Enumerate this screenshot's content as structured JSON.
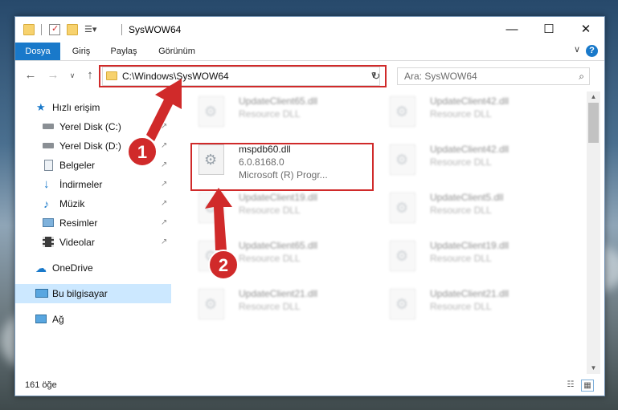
{
  "window": {
    "title": "SysWOW64",
    "controls": {
      "minimize": "—",
      "maximize": "☐",
      "close": "✕"
    }
  },
  "ribbon": {
    "tabs": [
      "Dosya",
      "Giriş",
      "Paylaş",
      "Görünüm"
    ],
    "help": "?",
    "collapse": "∨"
  },
  "nav": {
    "back": "←",
    "forward": "→",
    "recent": "∨",
    "up": "↑",
    "address": "C:\\Windows\\SysWOW64",
    "dropdown": "∨",
    "refresh": "↻",
    "search_placeholder": "Ara: SysWOW64",
    "search_icon": "⌕"
  },
  "sidebar": {
    "items": [
      {
        "label": "Hızlı erişim",
        "icon": "star-icon",
        "pinned": false
      },
      {
        "label": "Yerel Disk (C:)",
        "icon": "drive-icon",
        "pinned": true
      },
      {
        "label": "Yerel Disk (D:)",
        "icon": "drive-icon",
        "pinned": true
      },
      {
        "label": "Belgeler",
        "icon": "documents-icon",
        "pinned": true
      },
      {
        "label": "İndirmeler",
        "icon": "downloads-icon",
        "pinned": true
      },
      {
        "label": "Müzik",
        "icon": "music-icon",
        "pinned": true
      },
      {
        "label": "Resimler",
        "icon": "pictures-icon",
        "pinned": true
      },
      {
        "label": "Videolar",
        "icon": "videos-icon",
        "pinned": true
      },
      {
        "label": "OneDrive",
        "icon": "cloud-icon",
        "pinned": false
      },
      {
        "label": "Bu bilgisayar",
        "icon": "computer-icon",
        "pinned": false
      },
      {
        "label": "Ağ",
        "icon": "network-icon",
        "pinned": false
      }
    ],
    "pin_glyph": "↗"
  },
  "files": {
    "left": [
      {
        "name": "UpdateClient65.dll",
        "type": "Resource DLL"
      },
      {
        "name": "mspdb60.dll",
        "version": "6.0.8168.0",
        "company": "Microsoft (R) Progr..."
      },
      {
        "name": "UpdateClient19.dll",
        "type": "Resource DLL"
      },
      {
        "name": "UpdateClient65.dll",
        "type": "Resource DLL"
      },
      {
        "name": "UpdateClient21.dll",
        "type": "Resource DLL"
      }
    ],
    "right": [
      {
        "name": "UpdateClient42.dll",
        "type": "Resource DLL"
      },
      {
        "name": "UpdateClient42.dll",
        "type": "Resource DLL"
      },
      {
        "name": "UpdateClient5.dll",
        "type": "Resource DLL"
      },
      {
        "name": "UpdateClient19.dll",
        "type": "Resource DLL"
      },
      {
        "name": "UpdateClient21.dll",
        "type": "Resource DLL"
      }
    ]
  },
  "status": {
    "count": "161 öğe"
  },
  "annotations": {
    "step1": "1",
    "step2": "2",
    "color": "#d02a2a"
  }
}
